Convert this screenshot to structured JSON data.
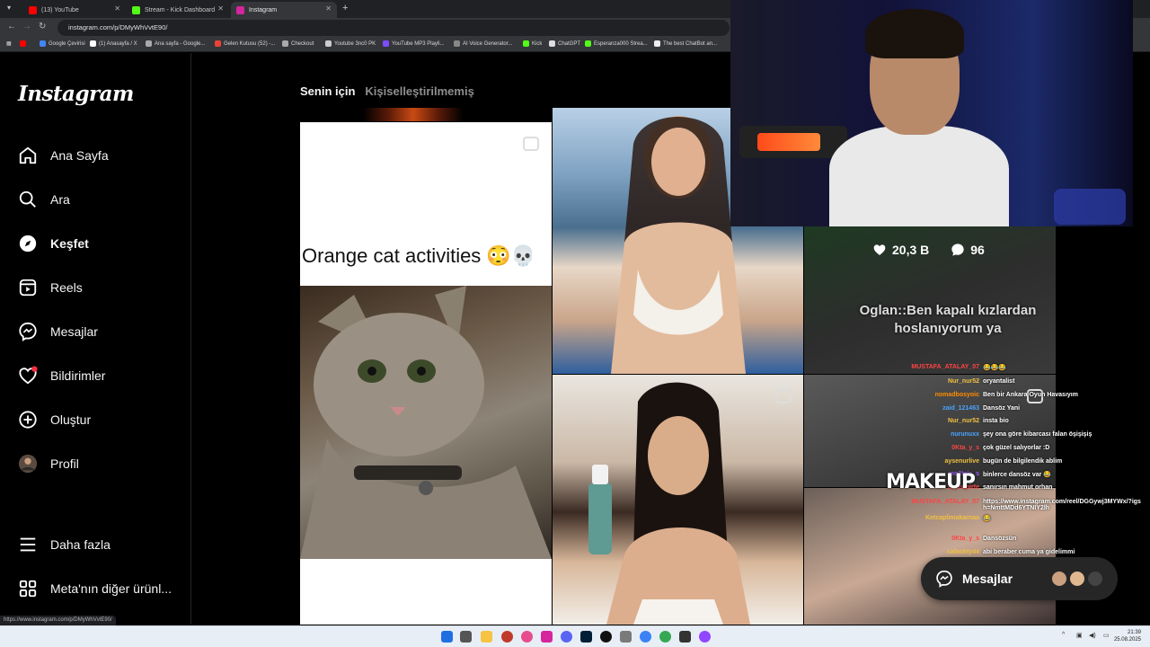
{
  "browser": {
    "tabs": [
      {
        "title": "(13) YouTube",
        "color": "#ff0000",
        "active": false
      },
      {
        "title": "Stream - Kick Dashboard",
        "color": "#53fc18",
        "active": false
      },
      {
        "title": "Instagram",
        "color": "#d6249f",
        "active": true
      }
    ],
    "url": "instagram.com/p/DMyWhVvtE90/",
    "bookmarks": [
      "Google Çevirisi",
      "(1) Anasayfa / X",
      "Ana sayfa - Google...",
      "Gelen Kutusu (52) -...",
      "Checkout",
      "Youtube 3nc0 PK",
      "YouTube MP3 Playli...",
      "AI Voice Generator...",
      "Kick",
      "ChatGPT",
      "Esperanza000 Strea...",
      "The best ChatBot an..."
    ],
    "status_url": "https://www.instagram.com/p/DMyWhVvtE90/"
  },
  "sidebar": {
    "logo": "Instagram",
    "items": [
      {
        "label": "Ana Sayfa",
        "icon": "home-icon"
      },
      {
        "label": "Ara",
        "icon": "search-icon"
      },
      {
        "label": "Keşfet",
        "icon": "compass-icon"
      },
      {
        "label": "Reels",
        "icon": "reels-icon"
      },
      {
        "label": "Mesajlar",
        "icon": "messenger-icon"
      },
      {
        "label": "Bildirimler",
        "icon": "heart-icon"
      },
      {
        "label": "Oluştur",
        "icon": "plus-square-icon"
      },
      {
        "label": "Profil",
        "icon": "avatar-icon"
      }
    ],
    "more": "Daha fazla",
    "meta": "Meta'nın diğer ürünl..."
  },
  "explore": {
    "tab_active": "Senin için",
    "tab_other": "Kişiselleştirilmemiş",
    "cat_caption": "Orange cat activities 😳💀",
    "likes": "20,3 B",
    "comments": "96",
    "overlay_caption": "Oglan::Ben kapalı kızlardan hoslanıyorum ya"
  },
  "chat": {
    "messages": [
      {
        "user": "MUSTAFA_ATALAY_07",
        "text": "😂😂😂",
        "color": "#ff4444"
      },
      {
        "user": "Nur_nur52",
        "text": "oryantalist",
        "color": "#f0c040"
      },
      {
        "user": "nomadbosyoic",
        "text": "Ben bir Ankara Oyun Havasıyım",
        "color": "#ff8c00"
      },
      {
        "user": "zaid_121463",
        "text": "Dansöz Yani",
        "color": "#4aa3ff"
      },
      {
        "user": "Nur_nur52",
        "text": "insta bio",
        "color": "#f0c040"
      },
      {
        "user": "nurunuxx",
        "text": "şey ona göre kibarcası falan öşişişiş",
        "color": "#4aa3ff"
      },
      {
        "user": "0Kta_y_s",
        "text": "çok güzel salıyorlar :D",
        "color": "#ff4444"
      },
      {
        "user": "aysenurlive",
        "text": "bugün de bilgilendik ablim",
        "color": "#f0c040"
      },
      {
        "user": "mo2tele_s",
        "text": "binlerce dansöz var 😂",
        "color": "#9b59ff"
      },
      {
        "user": "Zeynepirte",
        "text": "sanırsın mahmut orhan",
        "color": "#ff4444"
      },
      {
        "user": "MUSTAFA_ATALAY_07",
        "text": "https://www.instagram.com/reel/DGGywj3MYWx/?igsh=NmttMDd6YTNIY2lh",
        "color": "#ff4444"
      },
      {
        "user": "Ketcaplimakarnaa",
        "text": "😂",
        "color": "#f0c040"
      },
      {
        "user": "0Kta_y_s",
        "text": "Dansözsün",
        "color": "#ff4444"
      },
      {
        "user": "safaokty44",
        "text": "abi beraber cuma ya gidelimmi",
        "color": "#f0c040"
      }
    ],
    "makeup": "MAKEUP"
  },
  "messages_pill": {
    "label": "Mesajlar"
  },
  "taskbar": {
    "time": "21:39",
    "date": "25.08.2025"
  }
}
